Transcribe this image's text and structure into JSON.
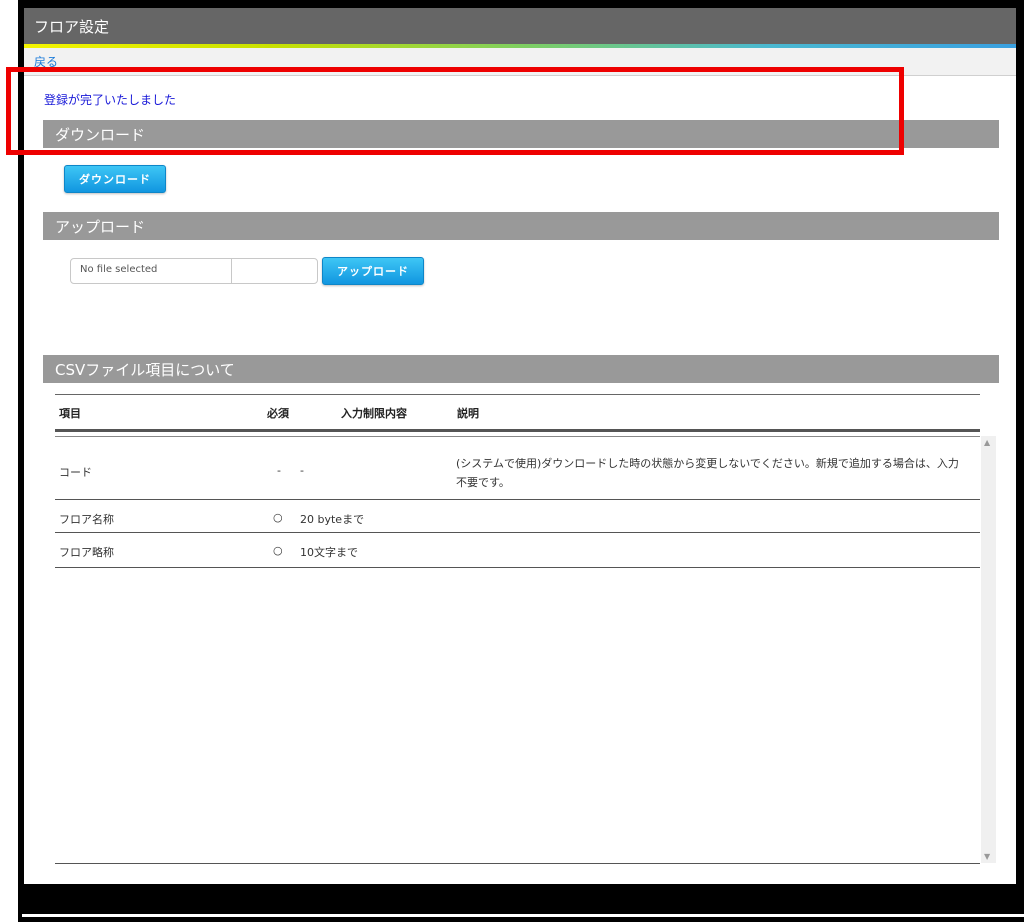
{
  "window": {
    "title": "フロア設定"
  },
  "nav": {
    "back_label": "戻る"
  },
  "message": "登録が完了いたしました",
  "download": {
    "section_title": "ダウンロード",
    "button_label": "ダウンロード"
  },
  "upload": {
    "section_title": "アップロード",
    "file_placeholder": "No file selected",
    "button_label": "アップロード"
  },
  "csv": {
    "section_title": "CSVファイル項目について",
    "headers": {
      "item": "項目",
      "required": "必須",
      "restriction": "入力制限内容",
      "description": "説明"
    },
    "rows": [
      {
        "item": "コード",
        "required": "-",
        "restriction": "-",
        "description": "(システムで使用)ダウンロードした時の状態から変更しないでください。新規で追加する場合は、入力不要です。"
      },
      {
        "item": "フロア名称",
        "required": "○",
        "restriction": "20 byteまで",
        "description": ""
      },
      {
        "item": "フロア略称",
        "required": "○",
        "restriction": "10文字まで",
        "description": ""
      }
    ]
  },
  "colors": {
    "title_bar": "#666666",
    "section_bar": "#999999",
    "button": "#1a9fe6",
    "message": "#1818d8",
    "highlight": "#ee0000"
  }
}
